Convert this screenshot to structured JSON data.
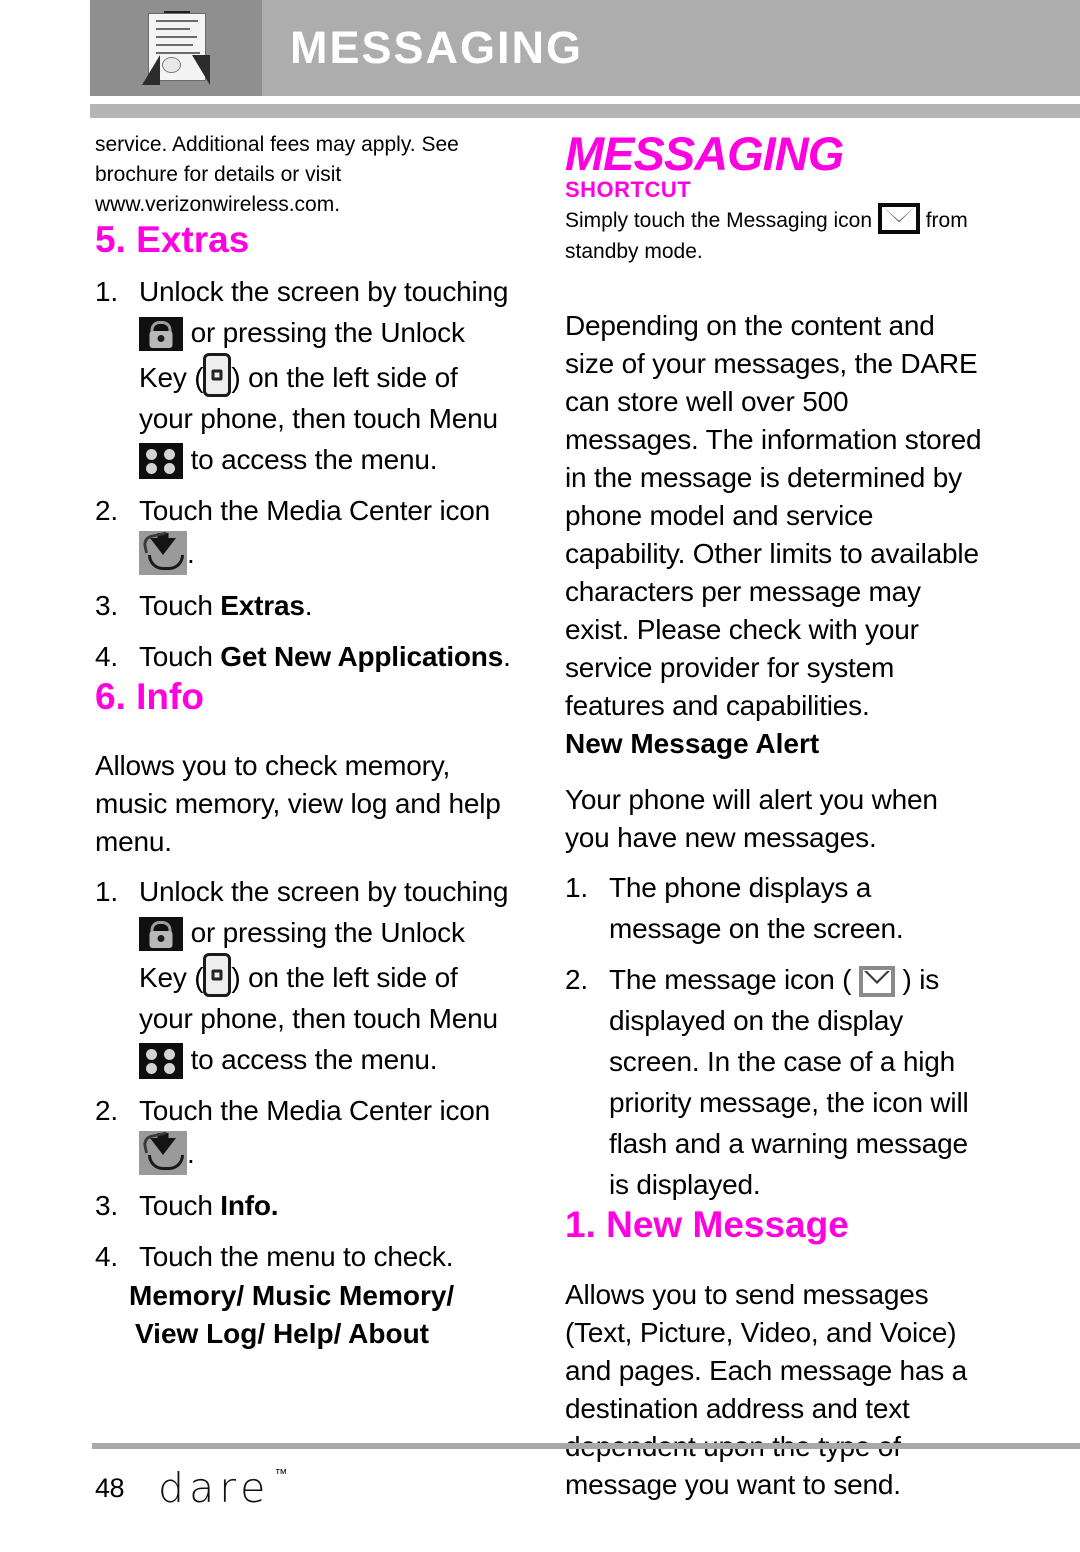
{
  "header": {
    "title": "MESSAGING",
    "icon": "envelope-document-icon"
  },
  "left_column": {
    "intro_paragraph": "service. Additional fees may apply. See brochure for details or visit www.verizonwireless.com.",
    "sections": [
      {
        "heading": "5. Extras",
        "steps": [
          {
            "num": "1.",
            "part1": "Unlock the screen by touching",
            "icon1": "lock-icon",
            "part2": "or pressing the Unlock Key (",
            "icon2": "unlock-key-icon",
            "part3": ") on the left side of your phone, then touch Menu",
            "icon3": "menu-grid-icon",
            "part4": "to access the menu."
          },
          {
            "num": "2.",
            "part1": "Touch the Media Center icon",
            "icon1": "media-center-icon",
            "part2": "."
          },
          {
            "num": "3.",
            "part1": "Touch ",
            "bold": "Extras",
            "part2": "."
          },
          {
            "num": "4.",
            "part1": "Touch ",
            "bold": "Get New Applications",
            "part2": "."
          }
        ]
      },
      {
        "heading": "6. Info",
        "description": "Allows you to check memory, music memory, view log and help menu.",
        "steps": [
          {
            "num": "1.",
            "part1": "Unlock the screen by touching",
            "icon1": "lock-icon",
            "part2": "or pressing the Unlock Key (",
            "icon2": "unlock-key-icon",
            "part3": ") on the left side of your phone, then touch Menu",
            "icon3": "menu-grid-icon",
            "part4": "to access the menu."
          },
          {
            "num": "2.",
            "part1": "Touch the Media Center icon",
            "icon1": "media-center-icon",
            "part2": "."
          },
          {
            "num": "3.",
            "part1": "Touch ",
            "bold": "Info.",
            "part2": ""
          },
          {
            "num": "4.",
            "part1": "Touch the menu to check.",
            "bold": "",
            "part2": ""
          }
        ],
        "menu_list": "Memory/ Music Memory/ View Log/ Help/ About"
      }
    ]
  },
  "right_column": {
    "title": "MESSAGING",
    "shortcut": {
      "label": "SHORTCUT",
      "text_before_icon": "Simply touch the Messaging icon",
      "icon": "messaging-envelope-icon",
      "text_after_icon": "from standby mode."
    },
    "intro_paragraph": "Depending on the content and size of your messages, the DARE can store well over 500 messages. The information stored in the message is determined by phone model and service capability. Other limits to available characters per message may exist. Please check with your service provider for system features and capabilities.",
    "new_message_alert": {
      "heading": "New Message Alert",
      "description": "Your phone will alert you when you have new messages.",
      "steps": [
        {
          "num": "1.",
          "part1": "The phone displays a message on the screen."
        },
        {
          "num": "2.",
          "part1": "The message icon (",
          "icon1": "message-small-icon",
          "part2": ") is displayed on the display screen. In the case of a high priority message, the icon will flash and a warning message is displayed."
        }
      ]
    },
    "new_message_section": {
      "heading": "1. New Message",
      "description": "Allows you to send messages (Text, Picture, Video, and Voice) and pages. Each message has a destination address and text dependent upon the type of message you want to send."
    }
  },
  "footer": {
    "page_number": "48",
    "brand": "Dare",
    "trademark": "™"
  },
  "colors": {
    "accent_magenta": "#ff00e0",
    "header_bg": "#adadad",
    "header_icon_bg": "#8f8f8f",
    "rule_gray": "#b4b4b4"
  }
}
